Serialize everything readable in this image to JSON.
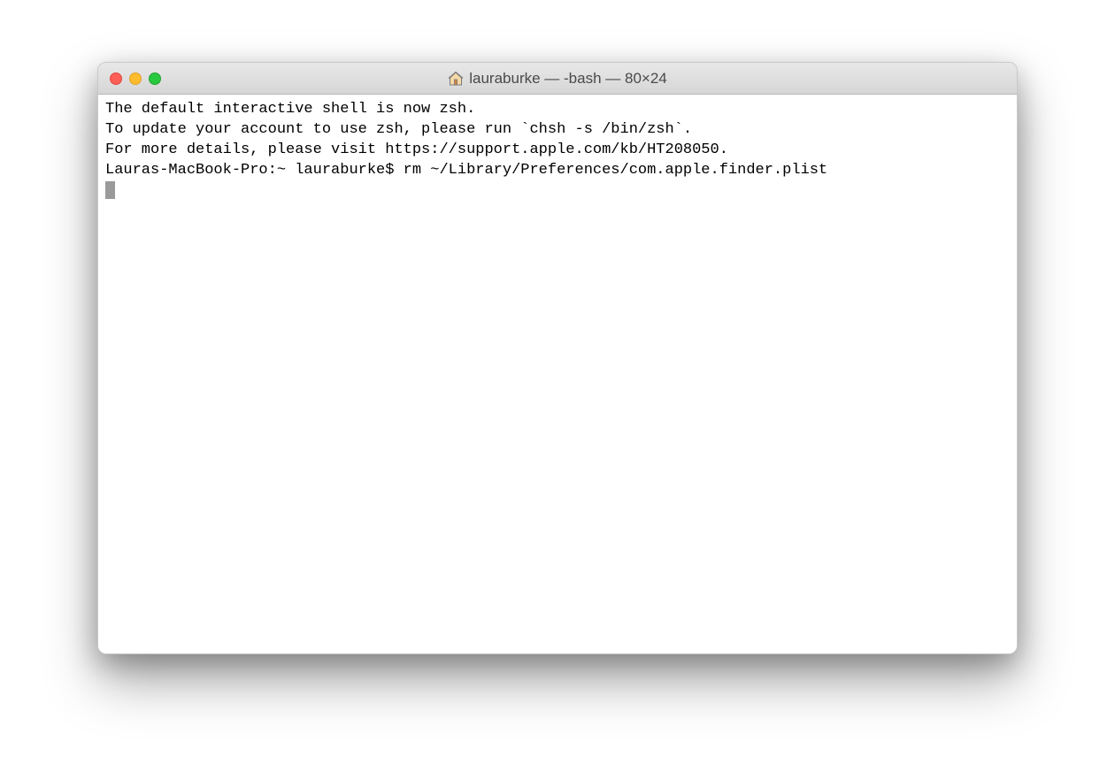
{
  "window": {
    "title": "lauraburke — -bash — 80×24"
  },
  "terminal": {
    "lines": [
      "The default interactive shell is now zsh.",
      "To update your account to use zsh, please run `chsh -s /bin/zsh`.",
      "For more details, please visit https://support.apple.com/kb/HT208050."
    ],
    "prompt": "Lauras-MacBook-Pro:~ lauraburke$ ",
    "command": "rm ~/Library/Preferences/com.apple.finder.plist"
  }
}
